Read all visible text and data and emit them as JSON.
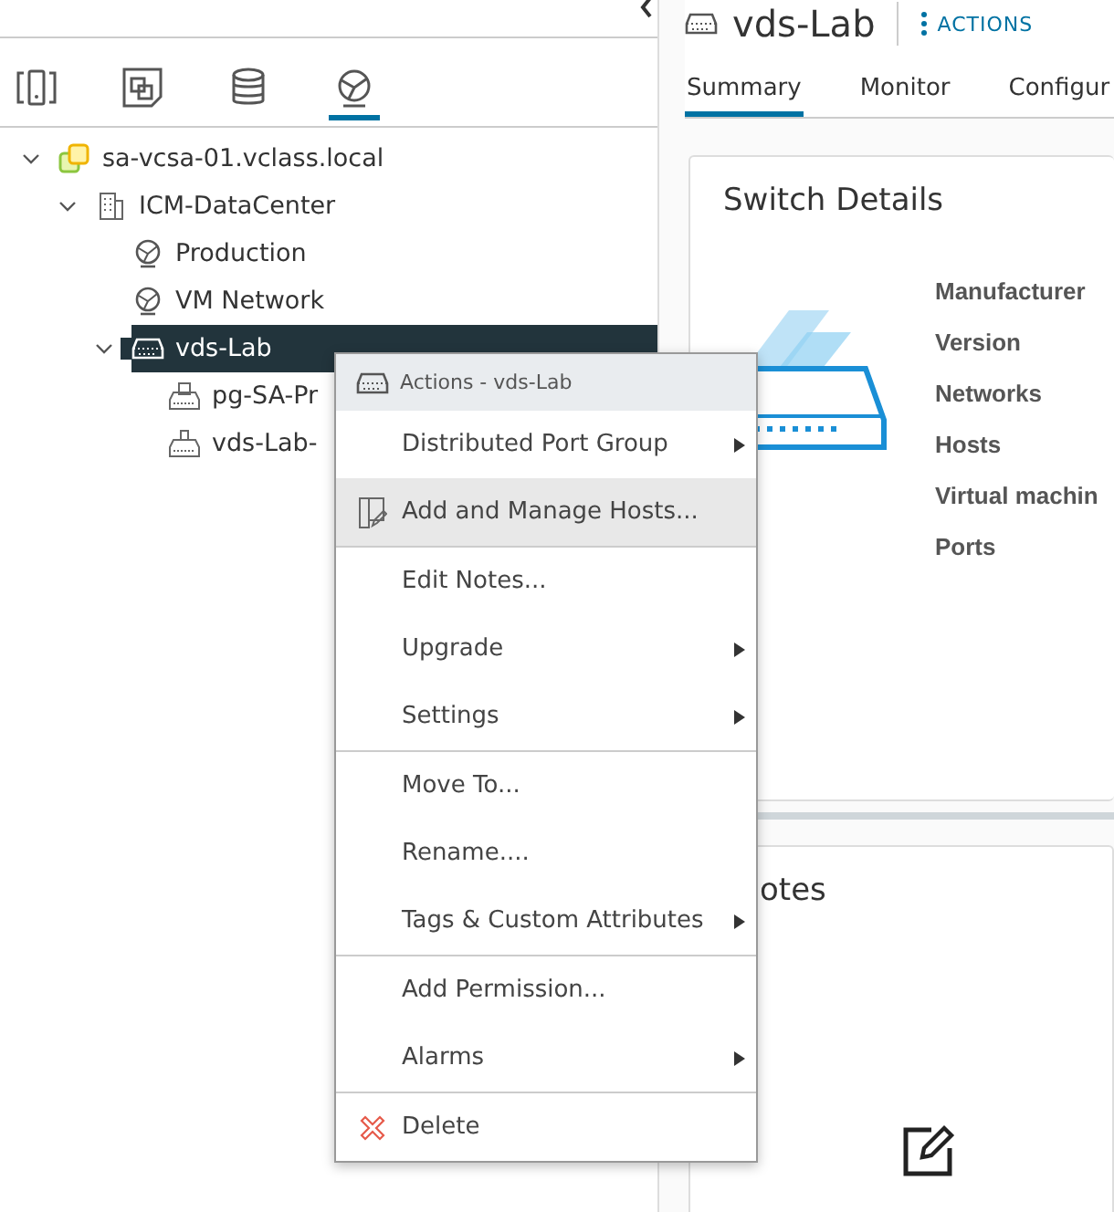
{
  "nav_tabs": [
    {
      "kind": "hosts",
      "selected": false
    },
    {
      "kind": "vms",
      "selected": false
    },
    {
      "kind": "storage",
      "selected": false
    },
    {
      "kind": "network",
      "selected": true
    }
  ],
  "tree": [
    {
      "label": "sa-vcsa-01.vclass.local",
      "kind": "vcenter",
      "expanded": true,
      "selected": false,
      "children": [
        {
          "label": "ICM-DataCenter",
          "kind": "datacenter",
          "expanded": true,
          "selected": false,
          "children": [
            {
              "label": "Production",
              "kind": "network",
              "selected": false
            },
            {
              "label": "VM Network",
              "kind": "network",
              "selected": false
            },
            {
              "label": "vds-Lab",
              "kind": "switch",
              "expanded": true,
              "selected": true,
              "children": [
                {
                  "label": "pg-SA-Pr",
                  "kind": "portgroup",
                  "selected": false
                },
                {
                  "label": "vds-Lab-",
                  "kind": "uplink",
                  "selected": false
                }
              ]
            }
          ]
        }
      ]
    }
  ],
  "header": {
    "title": "vds-Lab",
    "actions": "ACTIONS"
  },
  "tabs": [
    {
      "label": "Summary",
      "selected": true
    },
    {
      "label": "Monitor",
      "selected": false
    },
    {
      "label": "Configur",
      "selected": false
    }
  ],
  "switch_details": {
    "title": "Switch Details",
    "labels": [
      "Manufacturer",
      "Version",
      "Networks",
      "Hosts",
      "Virtual machin",
      "Ports"
    ]
  },
  "notes": {
    "title": "otes"
  },
  "context_menu": {
    "title": "Actions - vds-Lab",
    "groups": [
      [
        {
          "label": "Distributed Port Group",
          "submenu": true,
          "selected": false
        },
        {
          "label": "Add and Manage Hosts...",
          "kind": "hosts",
          "submenu": false,
          "selected": true
        }
      ],
      [
        {
          "label": "Edit Notes...",
          "submenu": false,
          "selected": false
        },
        {
          "label": "Upgrade",
          "submenu": true,
          "selected": false
        },
        {
          "label": "Settings",
          "submenu": true,
          "selected": false
        }
      ],
      [
        {
          "label": "Move To...",
          "submenu": false,
          "selected": false
        },
        {
          "label": "Rename....",
          "submenu": false,
          "selected": false
        },
        {
          "label": "Tags & Custom Attributes",
          "submenu": true,
          "selected": false
        }
      ],
      [
        {
          "label": "Add Permission...",
          "submenu": false,
          "selected": false
        },
        {
          "label": "Alarms",
          "submenu": true,
          "selected": false
        }
      ],
      [
        {
          "label": "Delete",
          "kind": "delete",
          "submenu": false,
          "selected": false
        }
      ]
    ]
  }
}
